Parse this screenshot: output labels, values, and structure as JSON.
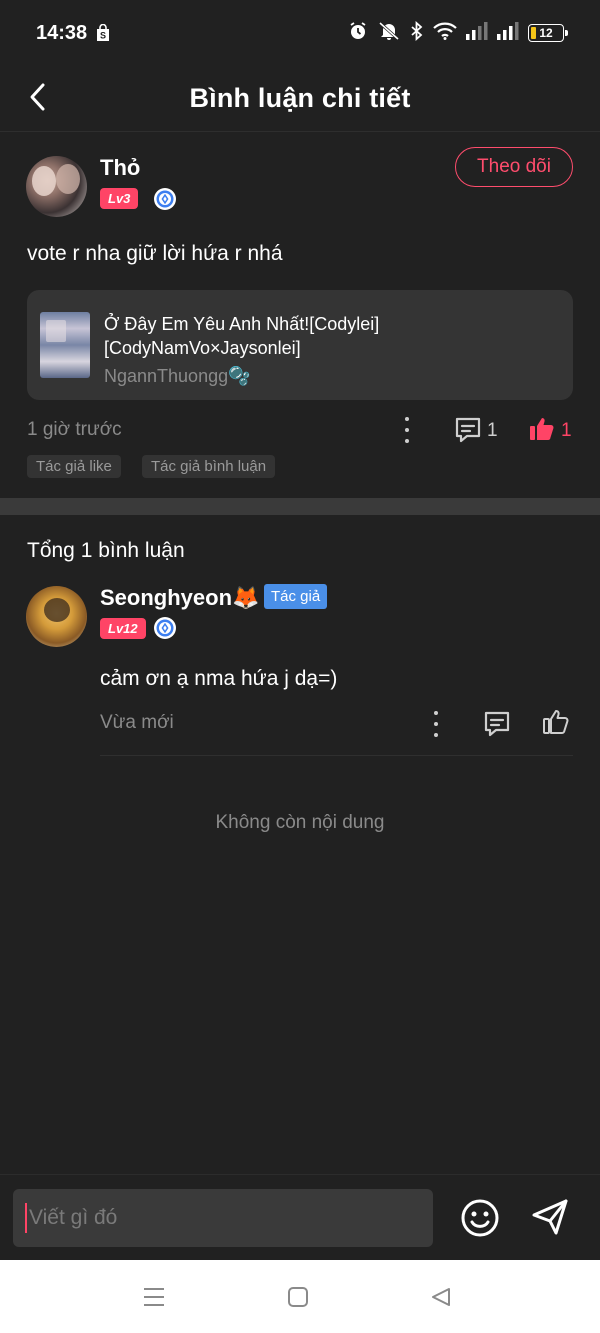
{
  "status": {
    "time": "14:38",
    "battery": "12"
  },
  "header": {
    "title": "Bình luận chi tiết"
  },
  "post": {
    "username": "Thỏ",
    "level": "Lv3",
    "follow_label": "Theo dõi",
    "text": "vote r nha giữ lời hứa r nhá",
    "book": {
      "title": "Ở Đây Em Yêu Anh Nhất![Codylei][CodyNamVo×Jaysonlei]",
      "author": "NgannThuongg🫧"
    },
    "time": "1 giờ trước",
    "comment_count": "1",
    "like_count": "1",
    "tags": [
      "Tác giả like",
      "Tác giả bình luận"
    ]
  },
  "comments_section": {
    "total": "Tổng 1 bình luận",
    "comments": [
      {
        "username": "Seonghyeon🦊",
        "author_tag": "Tác giả",
        "level": "Lv12",
        "text": "cảm ơn ạ nma hứa j dạ=)",
        "time": "Vừa mới"
      }
    ],
    "end_text": "Không còn nội dung"
  },
  "input": {
    "placeholder": "Viết gì đó"
  },
  "colors": {
    "accent": "#ff4466",
    "background": "#212121",
    "author_tag": "#4a8fe8",
    "muted": "#8a8a8a"
  }
}
